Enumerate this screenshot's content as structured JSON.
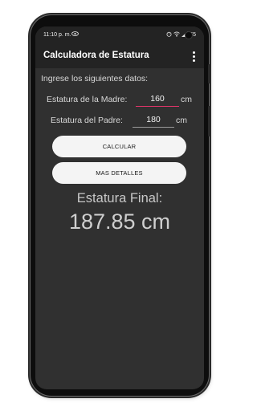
{
  "status_bar": {
    "time": "11:10 p. m.",
    "notification_icon": "eye-icon",
    "battery": "65"
  },
  "app_bar": {
    "title": "Calculadora de Estatura",
    "menu_icon": "overflow-menu-icon"
  },
  "form": {
    "instructions": "Ingrese los siguientes datos:",
    "mother": {
      "label": "Estatura de la Madre:",
      "value": "160",
      "unit": "cm"
    },
    "father": {
      "label": "Estatura del Padre:",
      "value": "180",
      "unit": "cm"
    }
  },
  "buttons": {
    "calculate": "CALCULAR",
    "more_details": "MAS DETALLES"
  },
  "result": {
    "label": "Estatura Final:",
    "value": "187.85 cm"
  },
  "colors": {
    "screen_bg": "#303030",
    "appbar_bg": "#232323",
    "accent_underline": "#e2346a"
  }
}
